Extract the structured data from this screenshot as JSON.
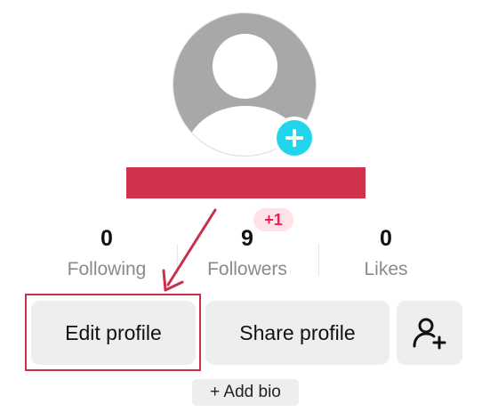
{
  "profile": {
    "avatar_icon": "default-avatar-icon",
    "add_avatar_icon": "plus-icon",
    "username_redacted": true,
    "colors": {
      "accent_cyan": "#20d5ec",
      "brand_red": "#ee1d52",
      "redaction": "#d0324e",
      "annotation": "#c8314c"
    }
  },
  "stats": {
    "following": {
      "value": "0",
      "label": "Following"
    },
    "followers": {
      "value": "9",
      "label": "Followers",
      "new_badge": "+1"
    },
    "likes": {
      "value": "0",
      "label": "Likes"
    }
  },
  "actions": {
    "edit_profile": "Edit profile",
    "share_profile": "Share profile",
    "add_friend_icon": "add-friend-icon"
  },
  "bio": {
    "add_bio": "+ Add bio"
  }
}
